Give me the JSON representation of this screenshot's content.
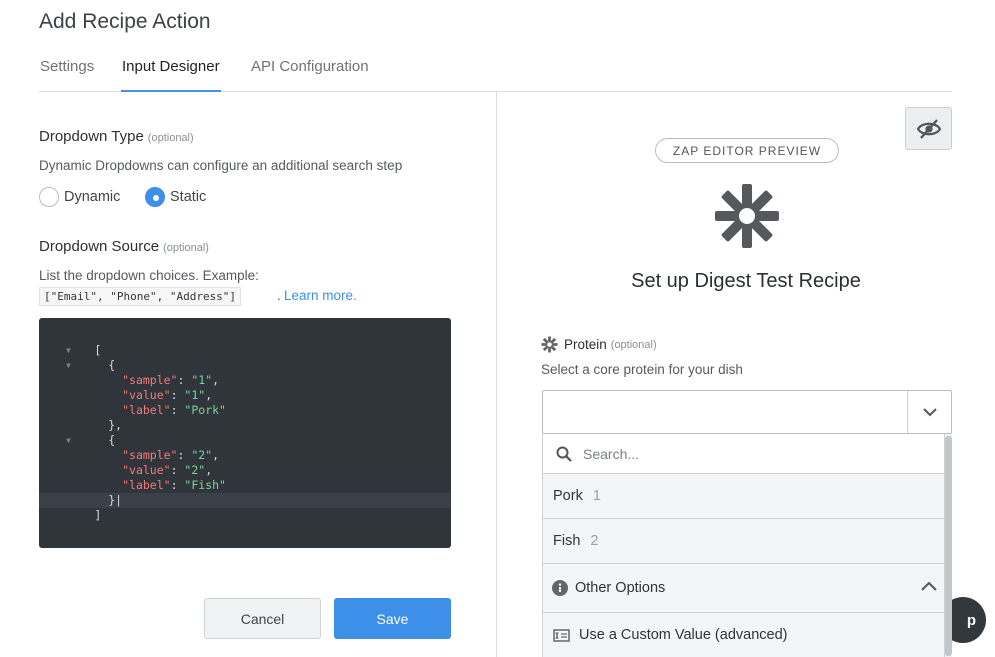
{
  "header": {
    "title": "Add Recipe Action"
  },
  "tabs": [
    {
      "label": "Settings"
    },
    {
      "label": "Input Designer",
      "active": true
    },
    {
      "label": "API Configuration"
    }
  ],
  "dropdown_type": {
    "label": "Dropdown Type",
    "optional": "(optional)",
    "help": "Dynamic Dropdowns can configure an additional search step",
    "options": [
      {
        "label": "Dynamic",
        "checked": false
      },
      {
        "label": "Static",
        "checked": true
      }
    ]
  },
  "dropdown_source": {
    "label": "Dropdown Source",
    "optional": "(optional)",
    "help": "List the dropdown choices. Example:",
    "example": "[\"Email\", \"Phone\", \"Address\"]",
    "period": ".",
    "learn_more": "Learn more.",
    "code": [
      "[",
      "  {",
      "    \"sample\": \"1\",",
      "    \"value\": \"1\",",
      "    \"label\": \"Pork\"",
      "  },",
      "  {",
      "    \"sample\": \"2\",",
      "    \"value\": \"2\",",
      "    \"label\": \"Fish\"",
      "  }",
      "]"
    ]
  },
  "actions": {
    "cancel": "Cancel",
    "save": "Save"
  },
  "preview": {
    "pill": "ZAP EDITOR PREVIEW",
    "title": "Set up Digest Test Recipe",
    "field_label": "Protein",
    "field_optional": "(optional)",
    "field_help": "Select a core protein for your dish",
    "search_placeholder": "Search...",
    "options": [
      {
        "label": "Pork",
        "value": "1"
      },
      {
        "label": "Fish",
        "value": "2"
      }
    ],
    "other_options": "Other Options",
    "custom_value": "Use a Custom Value (advanced)"
  },
  "help_bubble": "p",
  "colors": {
    "accent": "#3d8fe8",
    "editor_bg": "#2f353b",
    "code_key": "#f27a7a",
    "code_string": "#7ed39b"
  },
  "icons": [
    "eye-slash-icon",
    "zapier-logo-icon",
    "gear-icon",
    "search-icon",
    "chevron-down-icon",
    "info-icon",
    "chevron-up-icon",
    "custom-value-icon"
  ]
}
